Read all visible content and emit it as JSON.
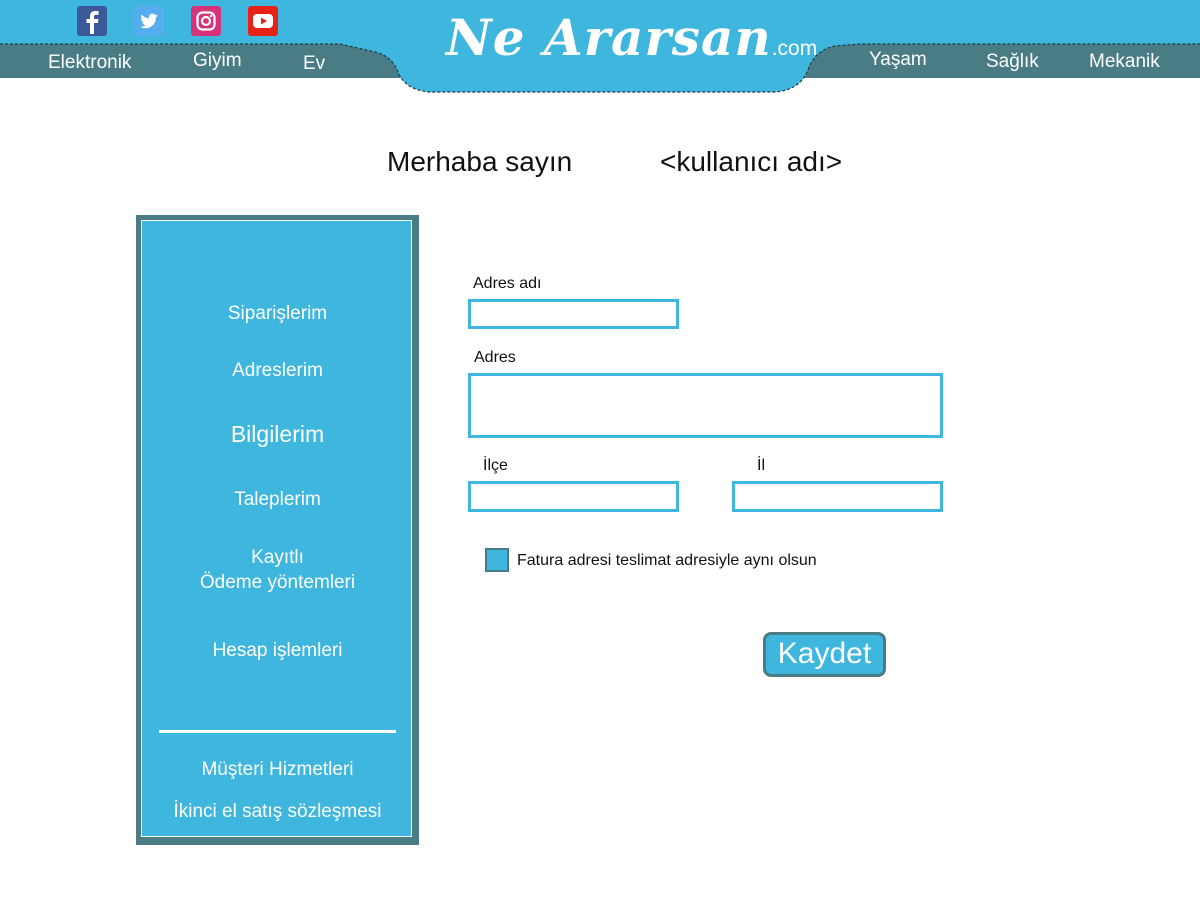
{
  "colors": {
    "primary": "#3fb6de",
    "dark_teal": "#4a7c86",
    "text": "#111111",
    "white": "#ffffff"
  },
  "header": {
    "social": [
      {
        "name": "facebook-icon",
        "color": "#3b5998"
      },
      {
        "name": "twitter-icon",
        "color": "#55acee"
      },
      {
        "name": "instagram-icon",
        "color": "#d6317a"
      },
      {
        "name": "youtube-icon",
        "color": "#e62117"
      }
    ],
    "logo_main": "Ne Ararsan",
    "logo_suffix": ".com",
    "nav_left": [
      "Elektronik",
      "Giyim",
      "Ev"
    ],
    "nav_right": [
      "Yaşam",
      "Sağlık",
      "Mekanik"
    ]
  },
  "greeting": {
    "prefix": "Merhaba sayın",
    "username": "<kullanıcı adı>"
  },
  "sidebar": {
    "items": [
      "Siparişlerim",
      "Adreslerim",
      "Bilgilerim",
      "Taleplerim",
      "Kayıtlı",
      "Ödeme yöntemleri",
      "Hesap işlemleri"
    ],
    "footer_items": [
      "Müşteri Hizmetleri",
      "İkinci el satış sözleşmesi"
    ]
  },
  "form": {
    "address_name_label": "Adres adı",
    "address_name_value": "",
    "address_label": "Adres",
    "address_value": "",
    "district_label": "İlçe",
    "district_value": "",
    "city_label": "İl",
    "city_value": "",
    "billing_same_label": "Fatura adresi teslimat adresiyle aynı olsun",
    "save_label": "Kaydet"
  }
}
